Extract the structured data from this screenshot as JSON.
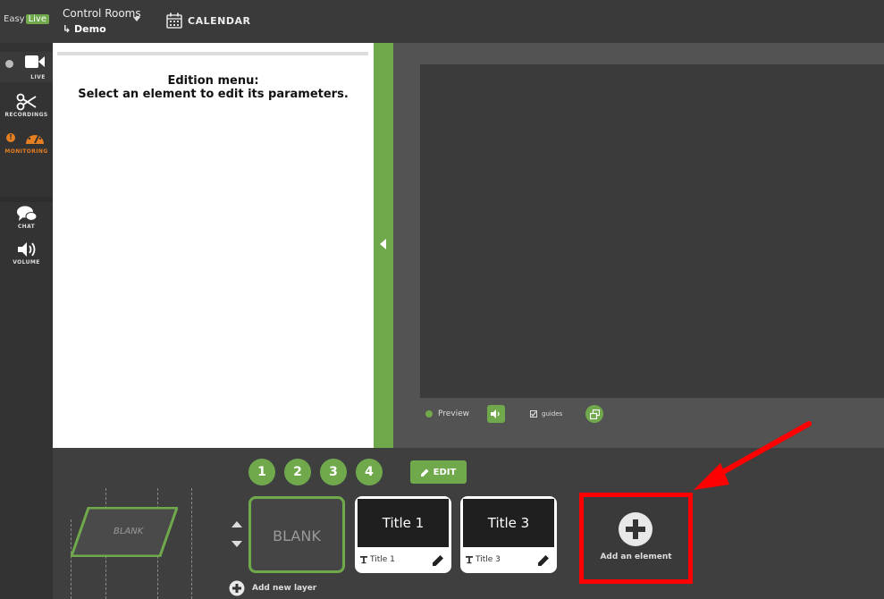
{
  "logo": {
    "part1": "Easy",
    "part2": "Live"
  },
  "header": {
    "control_rooms_label": "Control Rooms",
    "current_room": "↳ Demo",
    "calendar_label": "CALENDAR"
  },
  "sidebar": {
    "items": [
      {
        "label": "LIVE"
      },
      {
        "label": "RECORDINGS"
      },
      {
        "label": "MONITORING"
      },
      {
        "label": "CHAT"
      },
      {
        "label": "VOLUME"
      }
    ]
  },
  "edition": {
    "title": "Edition menu:",
    "subtitle": "Select an element to edit its parameters."
  },
  "preview": {
    "preview_label": "Preview",
    "guides_label": "guides"
  },
  "layers": {
    "tabs": [
      "1",
      "2",
      "3",
      "4"
    ],
    "edit_label": "EDIT",
    "blank_shape_label": "BLANK",
    "elements": [
      {
        "label": "BLANK"
      },
      {
        "top": "Title 1",
        "name": "Title 1"
      },
      {
        "top": "Title 3",
        "name": "Title 3"
      }
    ],
    "add_element_label": "Add an element",
    "add_layer_label": "Add new layer"
  },
  "colors": {
    "accent": "#70a84c",
    "highlight": "#ff0000",
    "monitoring": "#e67e22"
  }
}
